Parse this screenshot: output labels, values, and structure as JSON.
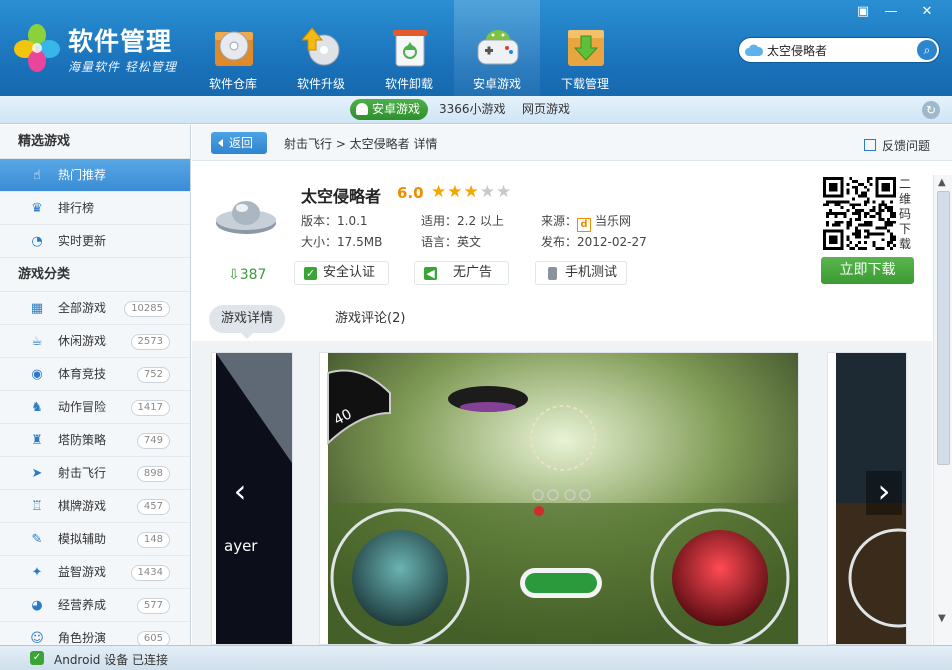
{
  "window": {
    "skin_icon": "▣",
    "minimize": "—",
    "close": "✕"
  },
  "brand": {
    "title": "软件管理",
    "subtitle": "海量软件 轻松管理"
  },
  "nav": [
    {
      "label": "软件仓库",
      "icon": "disc-box-icon"
    },
    {
      "label": "软件升级",
      "icon": "upgrade-arrow-icon"
    },
    {
      "label": "软件卸载",
      "icon": "recycle-bin-icon"
    },
    {
      "label": "安卓游戏",
      "icon": "android-gamepad-icon",
      "active": true
    },
    {
      "label": "下载管理",
      "icon": "download-box-icon"
    }
  ],
  "search": {
    "value": "太空侵略者",
    "button": "⌕"
  },
  "subnav": {
    "tabs": [
      "安卓游戏",
      "3366小游戏",
      "网页游戏"
    ],
    "refresh": "↻"
  },
  "sidebar": {
    "featured_title": "精选游戏",
    "featured": [
      {
        "label": "热门推荐",
        "icon": "hand-pointer-icon",
        "glyph": "☝",
        "active": true
      },
      {
        "label": "排行榜",
        "icon": "trophy-icon",
        "glyph": "♛"
      },
      {
        "label": "实时更新",
        "icon": "clock-icon",
        "glyph": "◔"
      }
    ],
    "category_title": "游戏分类",
    "categories": [
      {
        "label": "全部游戏",
        "count": "10285",
        "icon": "grid-icon",
        "glyph": "▦"
      },
      {
        "label": "休闲游戏",
        "count": "2573",
        "icon": "coffee-cup-icon",
        "glyph": "☕"
      },
      {
        "label": "体育竞技",
        "count": "752",
        "icon": "ball-icon",
        "glyph": "◉"
      },
      {
        "label": "动作冒险",
        "count": "1417",
        "icon": "runner-icon",
        "glyph": "♞"
      },
      {
        "label": "塔防策略",
        "count": "749",
        "icon": "tower-icon",
        "glyph": "♜"
      },
      {
        "label": "射击飞行",
        "count": "898",
        "icon": "paper-plane-icon",
        "glyph": "➤"
      },
      {
        "label": "棋牌游戏",
        "count": "457",
        "icon": "chess-rook-icon",
        "glyph": "♖"
      },
      {
        "label": "模拟辅助",
        "count": "148",
        "icon": "wrench-icon",
        "glyph": "✎"
      },
      {
        "label": "益智游戏",
        "count": "1434",
        "icon": "lightbulb-icon",
        "glyph": "✦"
      },
      {
        "label": "经营养成",
        "count": "577",
        "icon": "pie-icon",
        "glyph": "◕"
      },
      {
        "label": "角色扮演",
        "count": "605",
        "icon": "mask-icon",
        "glyph": "☺"
      }
    ]
  },
  "detail": {
    "back": "返回",
    "breadcrumb": "射击飞行 > 太空侵略者 详情",
    "feedback": "反馈问题",
    "name": "太空侵略者",
    "score": "6.0",
    "rating": 3,
    "rating_max": 5,
    "version": "版本：1.0.1",
    "size": "大小：17.5MB",
    "compat": "适用：2.2 以上",
    "language": "语言：英文",
    "source_label": "来源：",
    "source_icon_glyph": "d",
    "source_name": "当乐网",
    "published": "发布：2012-02-27",
    "downloads": "387",
    "badges": [
      "安全认证",
      "无广告",
      "手机测试"
    ],
    "qr_caption": "二维码下载",
    "download_button": "立即下载",
    "tabs": [
      "游戏详情",
      "游戏评论(2)"
    ],
    "gallery_prev": "‹",
    "gallery_next": "›",
    "shot_hud_number": "40",
    "shot_left_text": "ayer"
  },
  "status": {
    "text": "Android 设备 已连接",
    "check": "✓"
  },
  "colors": {
    "header": "#1a71b9",
    "accent_green": "#3c9b33",
    "star": "#f5a700",
    "score": "#f08c00"
  }
}
